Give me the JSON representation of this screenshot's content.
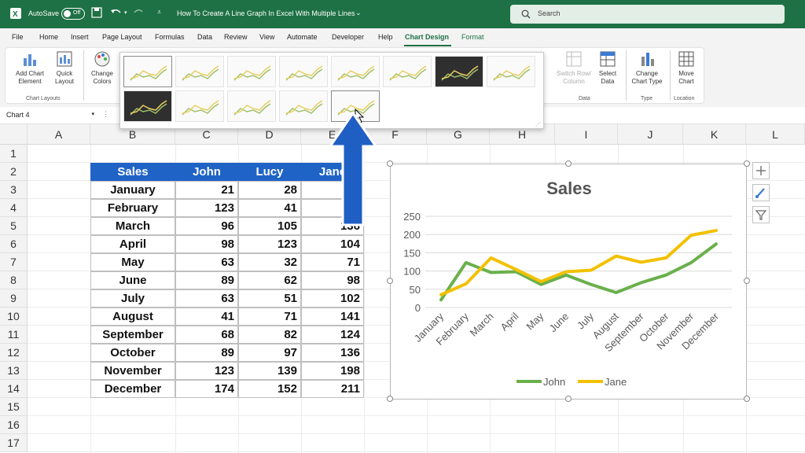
{
  "titlebar": {
    "autosave_label": "AutoSave",
    "toggle_label": "Off",
    "document_title": "How To Create A Line Graph In Excel With Multiple Lines",
    "search_placeholder": "Search"
  },
  "menu": {
    "tabs": [
      "File",
      "Home",
      "Insert",
      "Page Layout",
      "Formulas",
      "Data",
      "Review",
      "View",
      "Automate",
      "Developer",
      "Help",
      "Chart Design",
      "Format"
    ],
    "active_tab": "Chart Design"
  },
  "ribbon": {
    "add_chart_element": "Add Chart Element",
    "quick_layout": "Quick Layout",
    "change_colors": "Change Colors",
    "chart_layouts_group": "Chart Layouts",
    "switch_row_column": "Switch Row/ Column",
    "select_data": "Select Data",
    "data_group": "Data",
    "change_chart_type": "Change Chart Type",
    "type_group": "Type",
    "move_chart": "Move Chart",
    "location_group": "Location"
  },
  "formula_bar": {
    "name_box": "Chart 4"
  },
  "sheet": {
    "columns": [
      "A",
      "B",
      "C",
      "D",
      "E",
      "F",
      "G",
      "H",
      "I",
      "J",
      "K",
      "L"
    ],
    "rows": [
      "1",
      "2",
      "3",
      "4",
      "5",
      "6",
      "7",
      "8",
      "9",
      "10",
      "11",
      "12",
      "13",
      "14",
      "15",
      "16",
      "17"
    ],
    "table_headers": [
      "Sales",
      "John",
      "Lucy",
      "Jane"
    ],
    "table_rows": [
      [
        "January",
        "21",
        "28",
        ""
      ],
      [
        "February",
        "123",
        "41",
        ""
      ],
      [
        "March",
        "96",
        "105",
        "136"
      ],
      [
        "April",
        "98",
        "123",
        "104"
      ],
      [
        "May",
        "63",
        "32",
        "71"
      ],
      [
        "June",
        "89",
        "62",
        "98"
      ],
      [
        "July",
        "63",
        "51",
        "102"
      ],
      [
        "August",
        "41",
        "71",
        "141"
      ],
      [
        "September",
        "68",
        "82",
        "124"
      ],
      [
        "October",
        "89",
        "97",
        "136"
      ],
      [
        "November",
        "123",
        "139",
        "198"
      ],
      [
        "December",
        "174",
        "152",
        "211"
      ]
    ]
  },
  "colors": {
    "excel_green": "#1e7145",
    "header_blue": "#1f63c6",
    "arrow_blue": "#1f5fc4",
    "john_line": "#6ab04c",
    "jane_line": "#f2c100"
  },
  "chart_data": {
    "type": "line",
    "title": "Sales",
    "categories": [
      "January",
      "February",
      "March",
      "April",
      "May",
      "June",
      "July",
      "August",
      "September",
      "October",
      "November",
      "December"
    ],
    "series": [
      {
        "name": "John",
        "values": [
          21,
          123,
          96,
          98,
          63,
          89,
          63,
          41,
          68,
          89,
          123,
          174
        ]
      },
      {
        "name": "Jane",
        "values": [
          35,
          65,
          136,
          104,
          71,
          98,
          102,
          141,
          124,
          136,
          198,
          211
        ]
      }
    ],
    "y_ticks": [
      "0",
      "50",
      "100",
      "150",
      "200",
      "250"
    ],
    "ylim": [
      0,
      250
    ],
    "grid": true,
    "legend_position": "bottom"
  }
}
